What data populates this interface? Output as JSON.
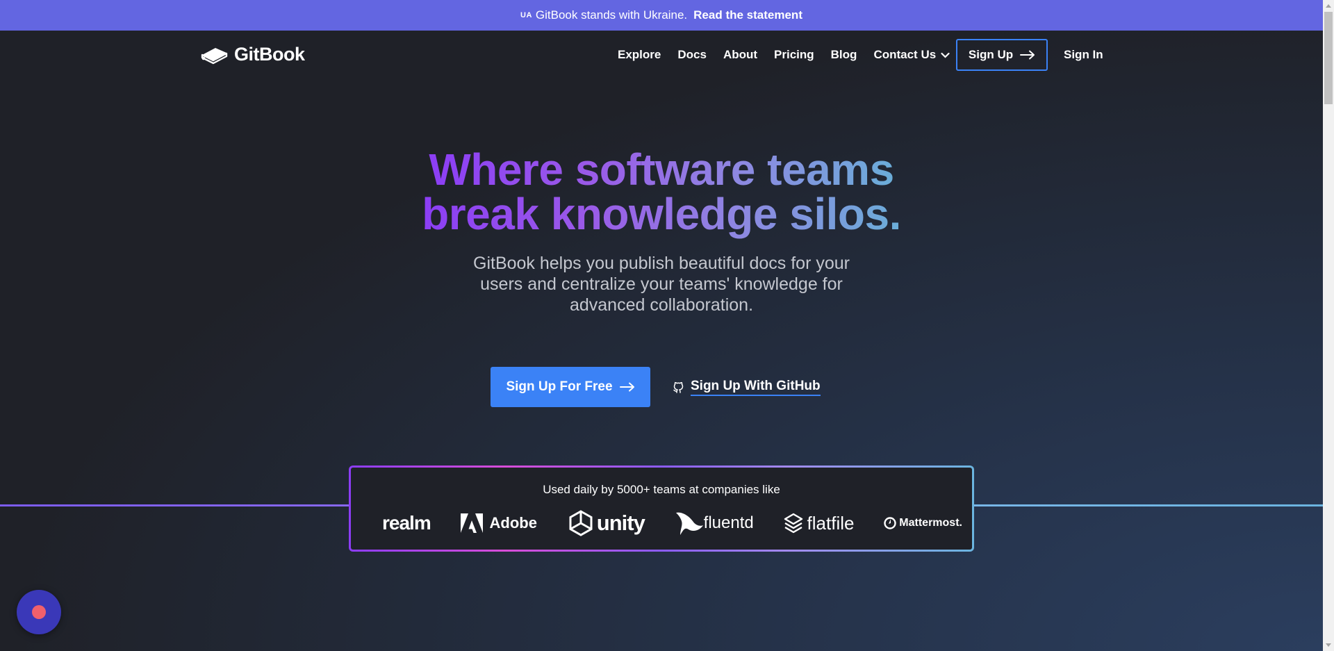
{
  "banner": {
    "flag": "UA",
    "text": "GitBook stands with Ukraine.",
    "link": "Read the statement"
  },
  "header": {
    "logo_text": "GitBook",
    "nav": [
      "Explore",
      "Docs",
      "About",
      "Pricing",
      "Blog",
      "Contact Us"
    ],
    "sign_up": "Sign Up",
    "sign_in": "Sign In"
  },
  "hero": {
    "headline_line1": "Where software teams",
    "headline_line2": "break knowledge silos.",
    "subtext": "GitBook helps you publish beautiful docs for your users and centralize your teams' knowledge for advanced collaboration.",
    "cta_primary": "Sign Up For Free",
    "cta_github": "Sign Up With GitHub"
  },
  "logos": {
    "title": "Used daily by 5000+ teams at companies like",
    "brands": [
      "realm",
      "Adobe",
      "unity",
      "fluentd",
      "flatfile",
      "Mattermost."
    ]
  },
  "colors": {
    "banner": "#6366e1",
    "primary": "#3b82f6",
    "background": "#1f2128",
    "chat_button": "#3a38b8"
  },
  "icons": [
    "gitbook-logo-icon",
    "chevron-down-icon",
    "arrow-right-icon",
    "github-icon",
    "chat-icon"
  ]
}
